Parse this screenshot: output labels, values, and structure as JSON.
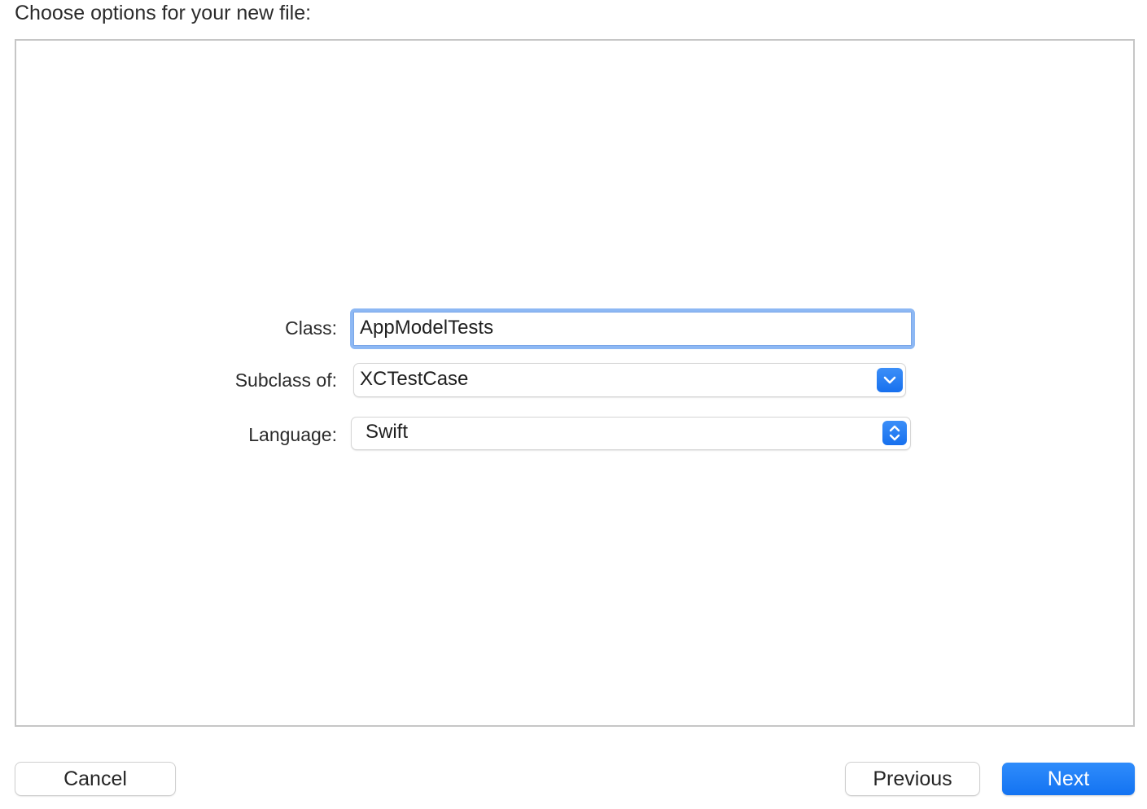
{
  "dialog": {
    "heading": "Choose options for your new file:"
  },
  "form": {
    "class_label": "Class:",
    "class_value": "AppModelTests",
    "subclass_label": "Subclass of:",
    "subclass_value": "XCTestCase",
    "language_label": "Language:",
    "language_value": "Swift"
  },
  "footer": {
    "cancel_label": "Cancel",
    "previous_label": "Previous",
    "next_label": "Next"
  },
  "colors": {
    "accent": "#1a77f2",
    "focus_ring": "#8db8f4"
  },
  "icons": {
    "subclass_dropdown": "chevron-down-icon",
    "language_popup": "up-down-chevron-icon"
  }
}
